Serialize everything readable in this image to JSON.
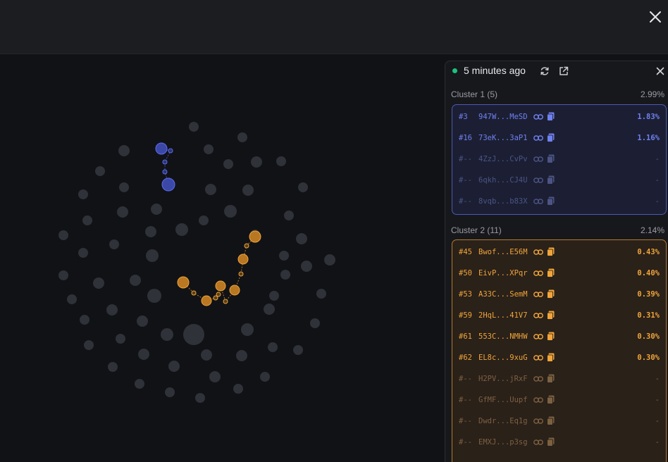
{
  "panel": {
    "updated_text": "5 minutes ago",
    "status_color": "#19c37d"
  },
  "clusters": [
    {
      "label": "Cluster 1 (5)",
      "pct": "2.99%",
      "color": "#5b6cf0",
      "rows": [
        {
          "rank": "#3",
          "address": "947W...MeSD",
          "pct": "1.83%",
          "dim": false
        },
        {
          "rank": "#16",
          "address": "73eK...3aP1",
          "pct": "1.16%",
          "dim": false
        },
        {
          "rank": "#--",
          "address": "4ZzJ...CvPv",
          "pct": "-",
          "dim": true
        },
        {
          "rank": "#--",
          "address": "6qkh...CJ4U",
          "pct": "-",
          "dim": true
        },
        {
          "rank": "#--",
          "address": "8vqb...b83X",
          "pct": "-",
          "dim": true
        }
      ]
    },
    {
      "label": "Cluster 2 (11)",
      "pct": "2.14%",
      "color": "#f0a43a",
      "rows": [
        {
          "rank": "#45",
          "address": "Bwof...E56M",
          "pct": "0.43%",
          "dim": false
        },
        {
          "rank": "#50",
          "address": "EivP...XPqr",
          "pct": "0.40%",
          "dim": false
        },
        {
          "rank": "#53",
          "address": "A33C...SemM",
          "pct": "0.39%",
          "dim": false
        },
        {
          "rank": "#59",
          "address": "2HqL...41V7",
          "pct": "0.31%",
          "dim": false
        },
        {
          "rank": "#61",
          "address": "553C...NMHW",
          "pct": "0.30%",
          "dim": false
        },
        {
          "rank": "#62",
          "address": "EL8c...9xuG",
          "pct": "0.30%",
          "dim": false
        },
        {
          "rank": "#--",
          "address": "H2PV...jRxF",
          "pct": "-",
          "dim": true
        },
        {
          "rank": "#--",
          "address": "GfMF...Uupf",
          "pct": "-",
          "dim": true
        },
        {
          "rank": "#--",
          "address": "Dwdr...Eq1g",
          "pct": "-",
          "dim": true
        },
        {
          "rank": "#--",
          "address": "EMXJ...p3sg",
          "pct": "-",
          "dim": true
        }
      ]
    }
  ],
  "icons": {
    "close": "close-icon",
    "refresh": "refresh-icon",
    "external": "external-link-icon",
    "link": "link-icon",
    "copy": "copy-icon"
  }
}
